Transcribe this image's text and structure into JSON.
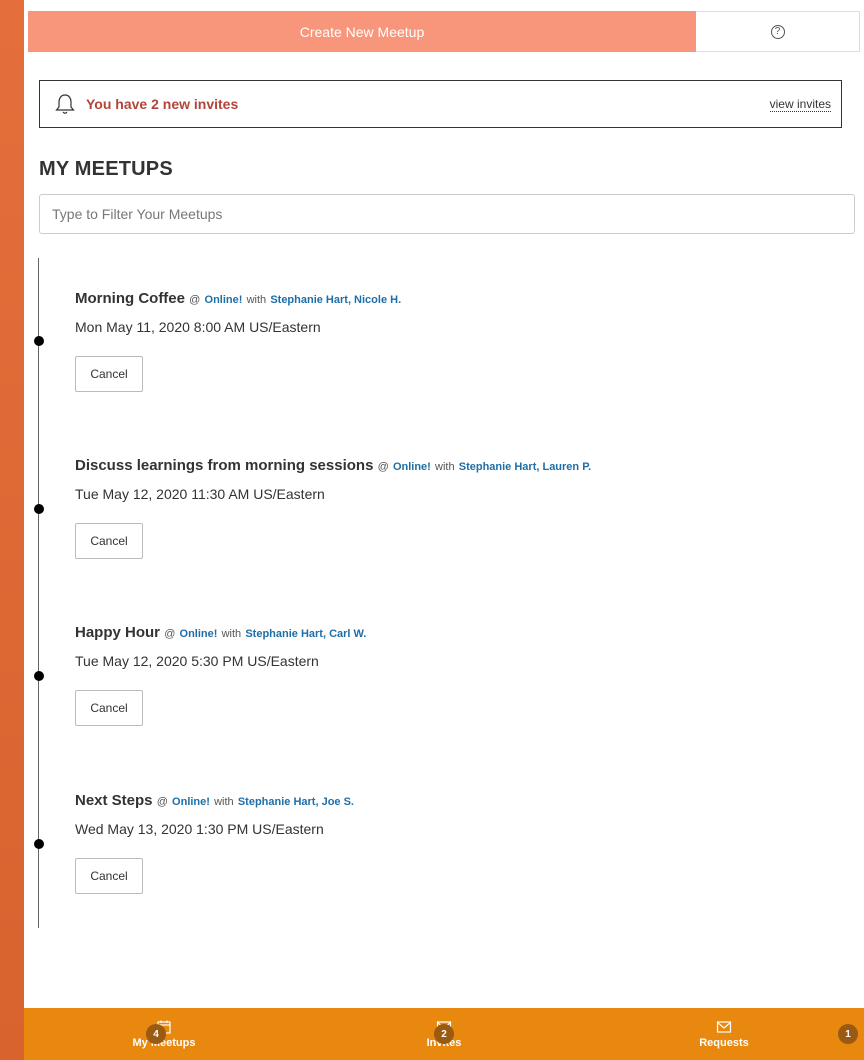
{
  "header": {
    "create_label": "Create New Meetup",
    "help_icon": "question-circle-icon"
  },
  "banner": {
    "message": "You have 2 new invites",
    "link": "view invites"
  },
  "page_title": "MY MEETUPS",
  "filter": {
    "placeholder": "Type to Filter Your Meetups",
    "value": ""
  },
  "meetups": [
    {
      "title": "Morning Coffee",
      "at": "@",
      "location": "Online!",
      "with": "with",
      "people": "Stephanie Hart, Nicole H.",
      "time": "Mon May 11, 2020 8:00 AM US/Eastern",
      "cancel": "Cancel"
    },
    {
      "title": "Discuss learnings from morning sessions",
      "at": "@",
      "location": "Online!",
      "with": "with",
      "people": "Stephanie Hart, Lauren P.",
      "time": "Tue May 12, 2020 11:30 AM US/Eastern",
      "cancel": "Cancel"
    },
    {
      "title": "Happy Hour",
      "at": "@",
      "location": "Online!",
      "with": "with",
      "people": "Stephanie Hart, Carl W.",
      "time": "Tue May 12, 2020 5:30 PM US/Eastern",
      "cancel": "Cancel"
    },
    {
      "title": "Next Steps",
      "at": "@",
      "location": "Online!",
      "with": "with",
      "people": "Stephanie Hart, Joe S.",
      "time": "Wed May 13, 2020 1:30 PM US/Eastern",
      "cancel": "Cancel"
    }
  ],
  "bottom_nav": [
    {
      "label": "My Meetups",
      "icon": "calendar-icon",
      "badge": "4"
    },
    {
      "label": "Invites",
      "icon": "envelope-icon",
      "badge": "2"
    },
    {
      "label": "Requests",
      "icon": "envelope-icon",
      "badge": "1"
    }
  ],
  "colors": {
    "accent": "#f7967a",
    "nav": "#e8880e",
    "link": "#1f6ea8",
    "alert": "#b4443a"
  }
}
